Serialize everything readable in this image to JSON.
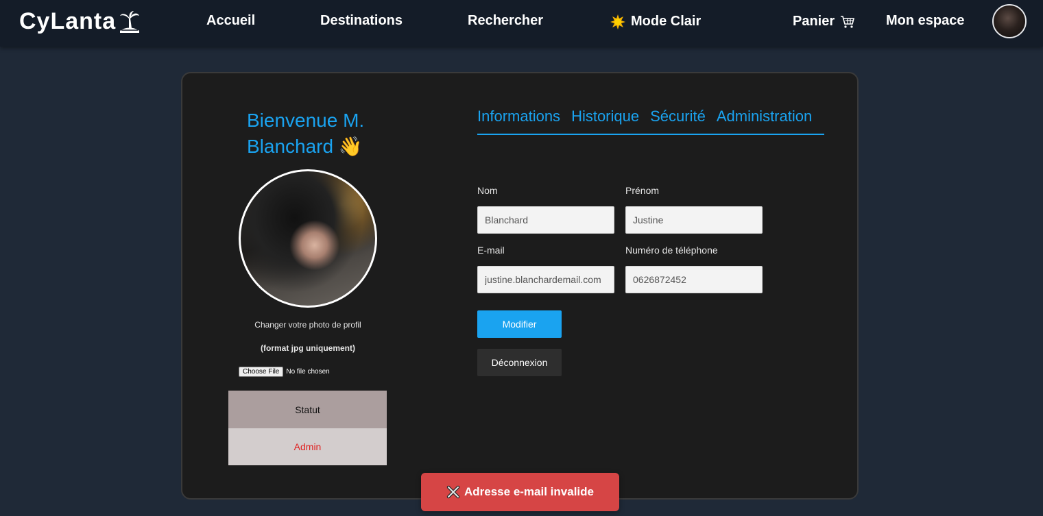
{
  "navbar": {
    "logo": "CyLanta",
    "links": {
      "home": "Accueil",
      "destinations": "Destinations",
      "search": "Rechercher",
      "mode": "Mode Clair",
      "cart": "Panier",
      "space": "Mon espace"
    },
    "icons": {
      "logo": "palm-tree-icon",
      "mode": "sun-icon",
      "cart": "shopping-cart-icon"
    }
  },
  "profile": {
    "welcome": "Bienvenue M. Blanchard",
    "welcome_emoji": "👋",
    "change_photo": "Changer votre photo de profil",
    "format_note": "(format jpg uniquement)",
    "file_button": "Choose File",
    "file_status": "No file chosen",
    "status_label": "Statut",
    "status_value": "Admin"
  },
  "tabs": [
    "Informations",
    "Historique",
    "Sécurité",
    "Administration"
  ],
  "form": {
    "nom_label": "Nom",
    "nom_value": "Blanchard",
    "prenom_label": "Prénom",
    "prenom_value": "Justine",
    "email_label": "E-mail",
    "email_value": "justine.blanchardemail.com",
    "phone_label": "Numéro de téléphone",
    "phone_value": "0626872452",
    "modify_button": "Modifier",
    "logout_button": "Déconnexion"
  },
  "toast": {
    "icon": "cross-mark-icon",
    "message": "Adresse e-mail invalide"
  },
  "colors": {
    "accent": "#1aa3f0",
    "navbar_bg": "#141c28",
    "page_bg": "#1f2937",
    "card_bg": "#1c1c1c",
    "toast_bg": "#d64545",
    "status_admin": "#e02020"
  }
}
